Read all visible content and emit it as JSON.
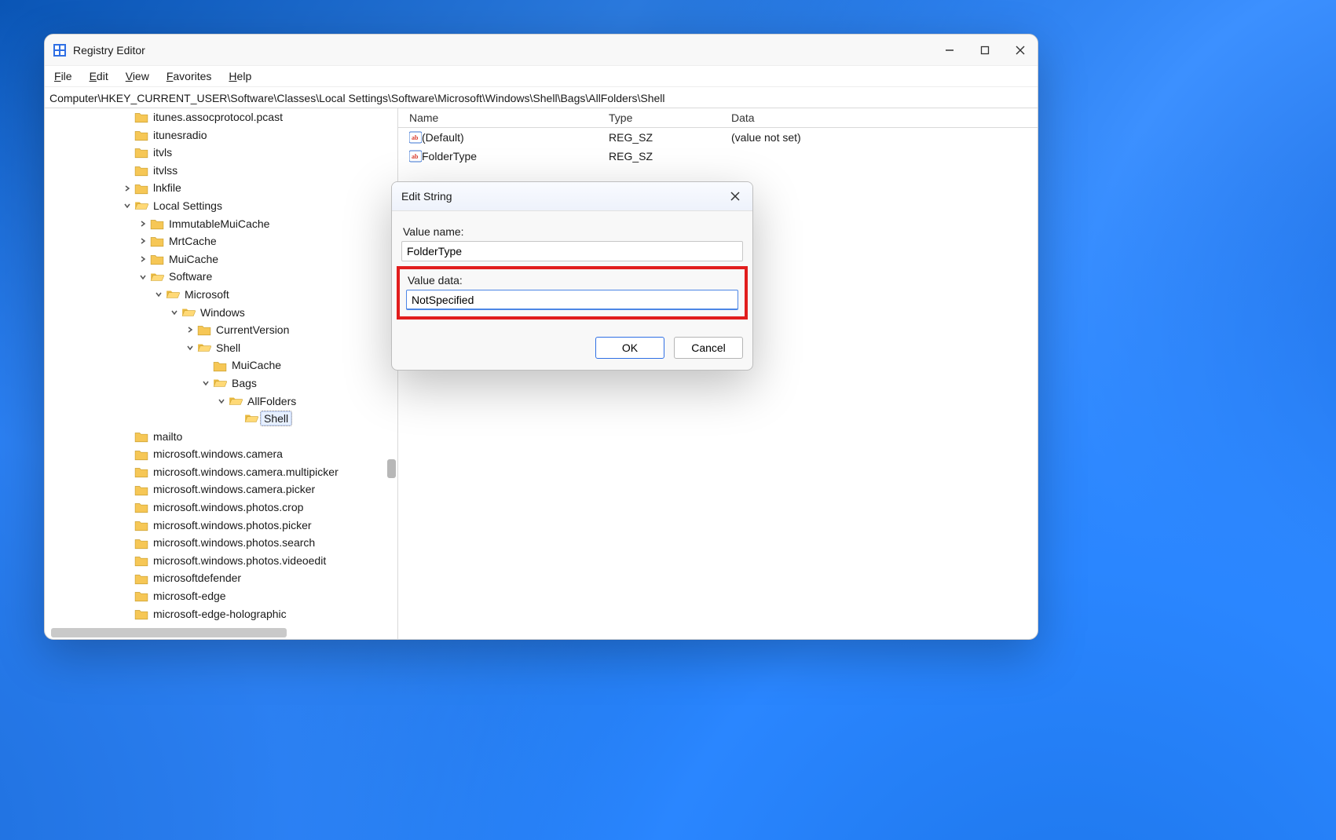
{
  "app": {
    "title": "Registry Editor",
    "menus": {
      "file": "File",
      "edit": "Edit",
      "view": "View",
      "favorites": "Favorites",
      "help": "Help"
    },
    "address_path": "Computer\\HKEY_CURRENT_USER\\Software\\Classes\\Local Settings\\Software\\Microsoft\\Windows\\Shell\\Bags\\AllFolders\\Shell"
  },
  "tree": {
    "items": [
      {
        "depth": 0,
        "expander": "none",
        "label": "itunes.assocprotocol.pcast"
      },
      {
        "depth": 0,
        "expander": "none",
        "label": "itunesradio"
      },
      {
        "depth": 0,
        "expander": "none",
        "label": "itvls"
      },
      {
        "depth": 0,
        "expander": "none",
        "label": "itvlss"
      },
      {
        "depth": 0,
        "expander": "right",
        "label": "lnkfile"
      },
      {
        "depth": 0,
        "expander": "down",
        "label": "Local Settings"
      },
      {
        "depth": 1,
        "expander": "right",
        "label": "ImmutableMuiCache"
      },
      {
        "depth": 1,
        "expander": "right",
        "label": "MrtCache"
      },
      {
        "depth": 1,
        "expander": "right",
        "label": "MuiCache"
      },
      {
        "depth": 1,
        "expander": "down",
        "label": "Software"
      },
      {
        "depth": 2,
        "expander": "down",
        "label": "Microsoft"
      },
      {
        "depth": 3,
        "expander": "down",
        "label": "Windows"
      },
      {
        "depth": 4,
        "expander": "right",
        "label": "CurrentVersion"
      },
      {
        "depth": 4,
        "expander": "down",
        "label": "Shell"
      },
      {
        "depth": 5,
        "expander": "none",
        "label": "MuiCache"
      },
      {
        "depth": 5,
        "expander": "down",
        "label": "Bags"
      },
      {
        "depth": 6,
        "expander": "down",
        "label": "AllFolders"
      },
      {
        "depth": 7,
        "expander": "none",
        "label": "Shell",
        "selected": true
      },
      {
        "depth": 0,
        "expander": "none",
        "label": "mailto"
      },
      {
        "depth": 0,
        "expander": "none",
        "label": "microsoft.windows.camera"
      },
      {
        "depth": 0,
        "expander": "none",
        "label": "microsoft.windows.camera.multipicker"
      },
      {
        "depth": 0,
        "expander": "none",
        "label": "microsoft.windows.camera.picker"
      },
      {
        "depth": 0,
        "expander": "none",
        "label": "microsoft.windows.photos.crop"
      },
      {
        "depth": 0,
        "expander": "none",
        "label": "microsoft.windows.photos.picker"
      },
      {
        "depth": 0,
        "expander": "none",
        "label": "microsoft.windows.photos.search"
      },
      {
        "depth": 0,
        "expander": "none",
        "label": "microsoft.windows.photos.videoedit"
      },
      {
        "depth": 0,
        "expander": "none",
        "label": "microsoftdefender"
      },
      {
        "depth": 0,
        "expander": "none",
        "label": "microsoft-edge"
      },
      {
        "depth": 0,
        "expander": "none",
        "label": "microsoft-edge-holographic"
      }
    ]
  },
  "list": {
    "headers": {
      "name": "Name",
      "type": "Type",
      "data": "Data"
    },
    "rows": [
      {
        "icon": "string-value-icon",
        "name": "(Default)",
        "type": "REG_SZ",
        "data": "(value not set)"
      },
      {
        "icon": "string-value-icon",
        "name": "FolderType",
        "type": "REG_SZ",
        "data": ""
      }
    ]
  },
  "dialog": {
    "title": "Edit String",
    "value_name_label": "Value name:",
    "value_name": "FolderType",
    "value_data_label": "Value data:",
    "value_data": "NotSpecified",
    "ok": "OK",
    "cancel": "Cancel"
  }
}
